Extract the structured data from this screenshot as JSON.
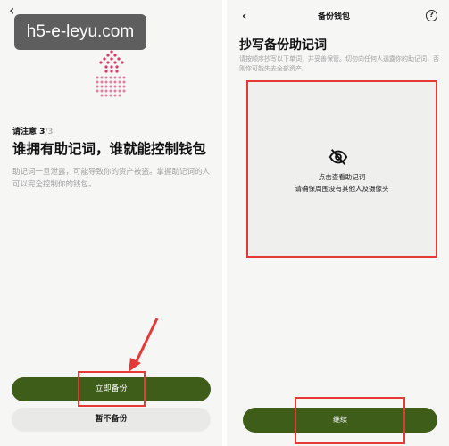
{
  "watermark": "h5-e-leyu.com",
  "left": {
    "back_icon": "‹",
    "notice_prefix": "请注意 3",
    "notice_suffix": "/3",
    "headline": "谁拥有助记词，谁就能控制钱包",
    "description": "助记词一旦泄露，可能导致你的资产被盗。掌握助记词的人可以完全控制你的钱包。",
    "primary_button": "立即备份",
    "secondary_button": "暂不备份"
  },
  "right": {
    "back_icon": "‹",
    "nav_title": "备份钱包",
    "help_icon": "?",
    "title": "抄写备份助记词",
    "subtitle": "请按顺序抄写以下单词，并妥善保管。切勿向任何人透露你的助记词，否则你可能失去全部资产。",
    "view_label": "点击查看助记词",
    "view_hint": "请确保周围没有其他人及摄像头",
    "continue_button": "继续"
  },
  "colors": {
    "primary_green": "#3e5d19",
    "highlight_red": "#e53935",
    "shield_pink": "#d9386a"
  },
  "icons": {
    "shield": "shield-dots-icon",
    "eye_slash": "eye-slash-icon",
    "help": "help-circle-icon"
  }
}
